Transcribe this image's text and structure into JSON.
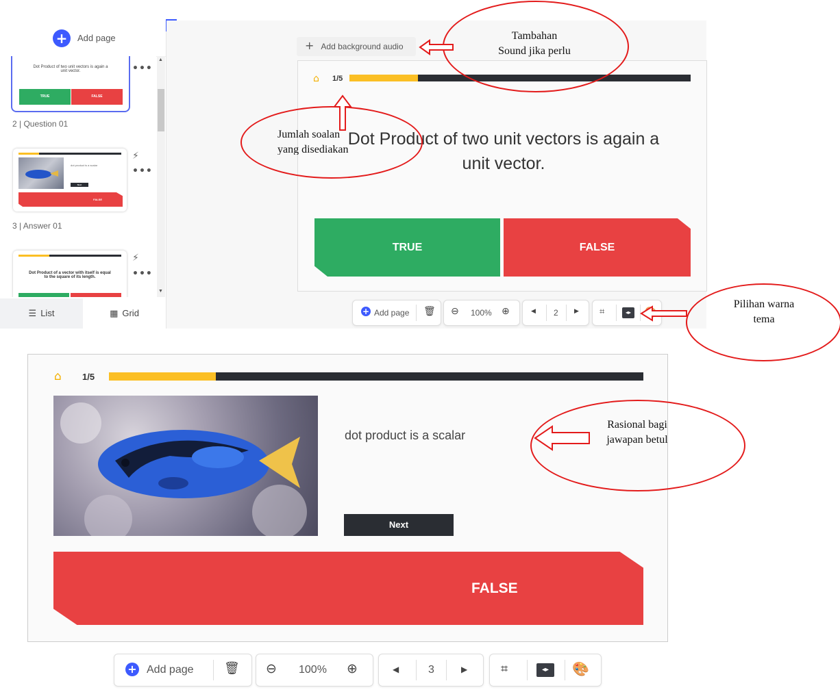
{
  "sidebar": {
    "add_page_label": "Add page",
    "thumbnails": [
      {
        "text": "Dot Product of two unit vectors is again a unit vector.",
        "true_label": "TRUE",
        "false_label": "FALSE"
      },
      {
        "caption": "2 | Question 01",
        "text": "dot product is a scalar",
        "next_label": "Next",
        "false_label": "FALSE"
      },
      {
        "caption": "3 | Answer 01",
        "text": "Dot Product of a vector with itself is equal to the square of its length."
      }
    ],
    "tabs": {
      "list": "List",
      "grid": "Grid"
    }
  },
  "editor": {
    "bg_audio_label": "Add background audio",
    "counter": "1/5",
    "progress_fraction": 0.2,
    "question": "Dot Product of two unit vectors is again a unit vector.",
    "true_label": "TRUE",
    "false_label": "FALSE",
    "toolbar": {
      "add_page": "Add page",
      "zoom": "100%",
      "page": "2"
    }
  },
  "annotations": {
    "audio_note_1": "Tambahan",
    "audio_note_2": "Sound jika perlu",
    "count_note_1": "Jumlah soalan",
    "count_note_2": "yang disediakan",
    "theme_note_1": "Pilihan warna",
    "theme_note_2": "tema",
    "rationale_note_1": "Rasional bagi",
    "rationale_note_2": "jawapan betul"
  },
  "answer_slide": {
    "counter": "1/5",
    "progress_fraction": 0.2,
    "rationale": "dot product is a scalar",
    "next_label": "Next",
    "false_label": "FALSE",
    "toolbar": {
      "add_page": "Add page",
      "zoom": "100%",
      "page": "3"
    }
  },
  "colors": {
    "true": "#2eac62",
    "false": "#e84142",
    "progress": "#fbbf24",
    "accent": "#3d5afe",
    "annotation": "#e31b1b"
  }
}
